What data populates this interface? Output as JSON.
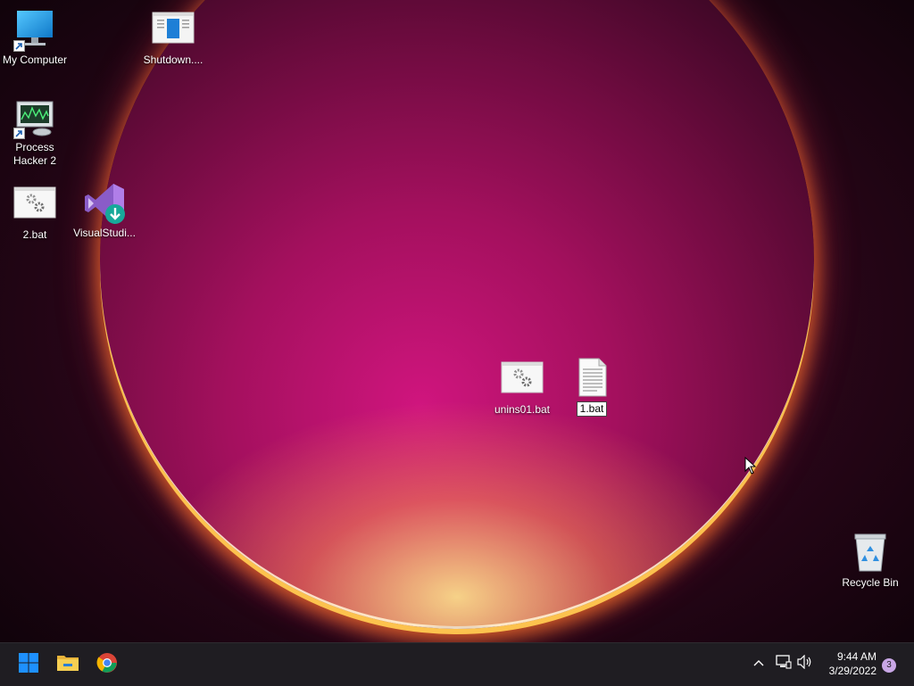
{
  "desktop": {
    "icons": [
      {
        "label": "My Computer",
        "icon": "monitor-icon"
      },
      {
        "label": "Shutdown....",
        "icon": "shutdown-window-icon"
      },
      {
        "label": "Process Hacker 2",
        "icon": "process-hacker-icon"
      },
      {
        "label": "2.bat",
        "icon": "batch-file-icon"
      },
      {
        "label": "VisualStudi...",
        "icon": "visual-studio-installer-icon"
      },
      {
        "label": "unins01.bat",
        "icon": "batch-file-icon"
      },
      {
        "label": "1.bat",
        "icon": "text-file-icon",
        "selected": true
      },
      {
        "label": "Recycle Bin",
        "icon": "recycle-bin-icon"
      }
    ]
  },
  "taskbar": {
    "pinned": [
      {
        "name": "Start",
        "icon": "windows-start-icon"
      },
      {
        "name": "File Explorer",
        "icon": "folder-icon"
      },
      {
        "name": "Google Chrome",
        "icon": "chrome-icon"
      }
    ],
    "tray": {
      "overflow_icon": "chevron-up-icon",
      "network_icon": "network-icon",
      "volume_icon": "speaker-icon"
    },
    "clock": {
      "time": "9:44 AM",
      "date": "3/29/2022"
    },
    "notification_count": "3"
  },
  "colors": {
    "taskbar_bg": "#1f1d22",
    "notification_badge": "#c9a7e6",
    "accent_blue": "#1e90ff"
  }
}
